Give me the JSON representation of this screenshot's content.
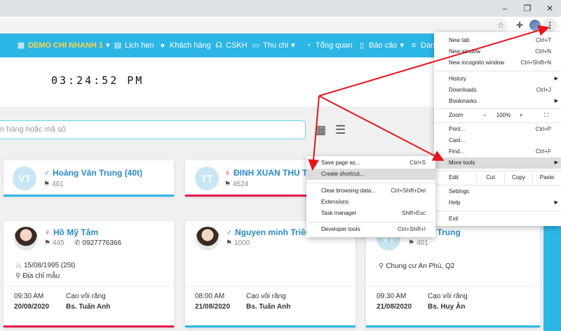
{
  "browser": {
    "minimize_glyph": "–",
    "restore_glyph": "❐",
    "close_glyph": "✕",
    "star_glyph": "☆",
    "extensions_glyph": "✚",
    "menu_glyph": "⋮"
  },
  "nav": {
    "branch": "DEMO CHI NHANH 1",
    "items": [
      {
        "label": "Lịch hẹn",
        "icon": "calendar-icon"
      },
      {
        "label": "Khách hàng",
        "icon": "user-icon"
      },
      {
        "label": "CSKH",
        "icon": "headset-icon"
      },
      {
        "label": "Thu chi",
        "icon": "money-icon"
      },
      {
        "label": "Tổng quan",
        "icon": "dashboard-icon"
      },
      {
        "label": "Báo cáo",
        "icon": "report-icon"
      },
      {
        "label": "Dan",
        "icon": "list-icon"
      }
    ]
  },
  "clock": "03:24:52 PM",
  "search": {
    "placeholder": "n hàng hoặc mã số"
  },
  "cards": [
    {
      "initials": "VT",
      "name": "Hoàng Văn Trung (40t)",
      "sex": "♂",
      "code": "401"
    },
    {
      "initials": "TT",
      "name": "ĐINH XUAN THU TR",
      "sex": "♀",
      "code": "4524"
    },
    {
      "name": "Hồ Mỹ Tâm",
      "sex": "♀",
      "code": "445",
      "phone": "0927776366",
      "dob": "15/08/1995 (25t)",
      "address": "Địa chỉ mẫu",
      "time": "09:30 AM",
      "date": "20/08/2020",
      "service": "Cạo vôi răng",
      "doctor": "Bs. Tuấn Anh"
    },
    {
      "name": "Nguyen minh Triều",
      "sex": "♂",
      "code": "1000",
      "time": "08:00 AM",
      "date": "21/08/2020",
      "service": "Cạo vôi răng",
      "doctor": "Bs. Tuấn Anh"
    },
    {
      "initials": "VT",
      "name": "ng Văn Trung",
      "code": "401",
      "address": "Chung cư An Phú, Q2",
      "time": "09:30 AM",
      "date": "21/08/2020",
      "service": "Cạo vôi răng",
      "doctor": "Bs. Huy Ân"
    }
  ],
  "menu": {
    "new_tab": "New tab",
    "new_tab_sc": "Ctrl+T",
    "new_window": "New window",
    "new_window_sc": "Ctrl+N",
    "new_incognito": "New incognito window",
    "new_incognito_sc": "Ctrl+Shift+N",
    "history": "History",
    "downloads": "Downloads",
    "downloads_sc": "Ctrl+J",
    "bookmarks": "Bookmarks",
    "zoom": "Zoom",
    "zoom_minus": "–",
    "zoom_value": "100%",
    "zoom_plus": "+",
    "fullscreen": "⛶",
    "print": "Print...",
    "print_sc": "Ctrl+P",
    "cast": "Cast...",
    "find": "Find...",
    "find_sc": "Ctrl+F",
    "more_tools": "More tools",
    "edit": "Edit",
    "cut": "Cut",
    "copy": "Copy",
    "paste": "Paste",
    "settings": "Settings",
    "help": "Help",
    "exit": "Exit"
  },
  "submenu": {
    "save_page": "Save page as...",
    "save_page_sc": "Ctrl+S",
    "create_shortcut": "Create shortcut...",
    "clear_browsing": "Clear browsing data...",
    "clear_browsing_sc": "Ctrl+Shift+Del",
    "extensions": "Extensions",
    "task_manager": "Task manager",
    "task_manager_sc": "Shift+Esc",
    "developer_tools": "Developer tools",
    "developer_tools_sc": "Ctrl+Shift+I"
  },
  "colors": {
    "nav": "#2cb6e6",
    "branch": "#ffd54a",
    "accent_red": "#e6194b",
    "annotation": "#e8141c"
  }
}
